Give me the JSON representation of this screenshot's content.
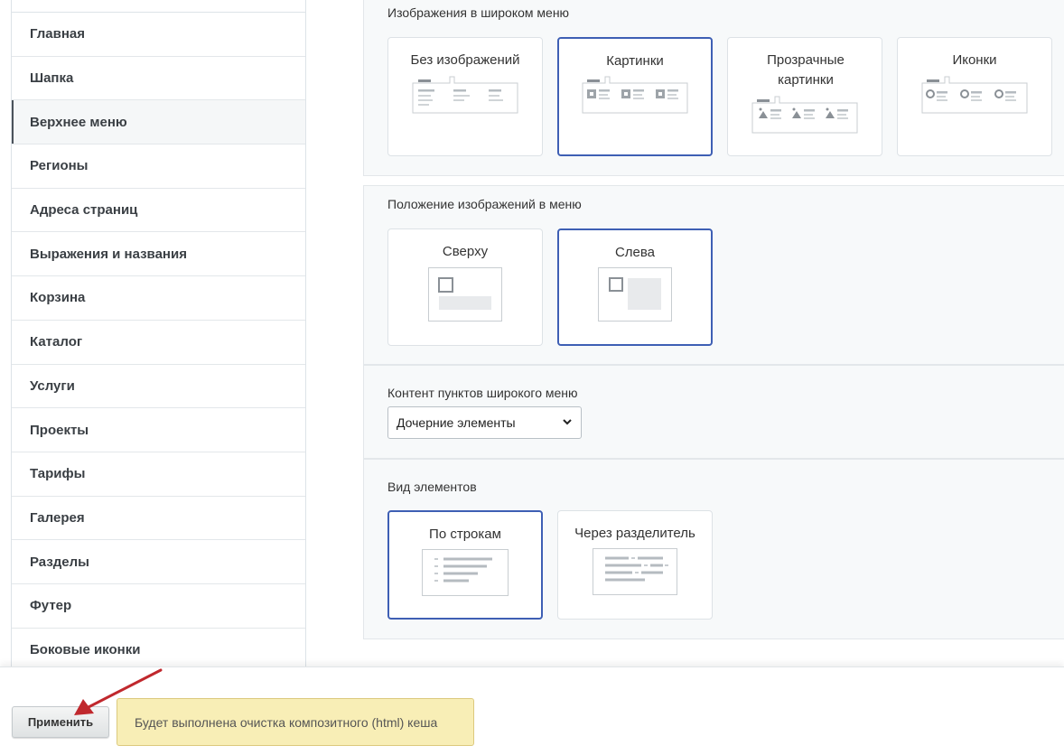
{
  "sidebar": {
    "items": [
      {
        "label": "Главная"
      },
      {
        "label": "Шапка"
      },
      {
        "label": "Верхнее меню"
      },
      {
        "label": "Регионы"
      },
      {
        "label": "Адреса страниц"
      },
      {
        "label": "Выражения и названия"
      },
      {
        "label": "Корзина"
      },
      {
        "label": "Каталог"
      },
      {
        "label": "Услуги"
      },
      {
        "label": "Проекты"
      },
      {
        "label": "Тарифы"
      },
      {
        "label": "Галерея"
      },
      {
        "label": "Разделы"
      },
      {
        "label": "Футер"
      },
      {
        "label": "Боковые иконки"
      }
    ],
    "active_index": 2
  },
  "sections": {
    "images_in_menu": {
      "title": "Изображения в широком меню",
      "options": [
        {
          "label": "Без изображений",
          "selected": false
        },
        {
          "label": "Картинки",
          "selected": true
        },
        {
          "label": "Прозрачные картинки",
          "selected": false
        },
        {
          "label": "Иконки",
          "selected": false
        }
      ]
    },
    "image_position": {
      "title": "Положение изображений в меню",
      "options": [
        {
          "label": "Сверху",
          "selected": false
        },
        {
          "label": "Слева",
          "selected": true
        }
      ]
    },
    "content": {
      "title": "Контент пунктов широкого меню",
      "select_value": "Дочерние элементы"
    },
    "view": {
      "title": "Вид элементов",
      "options": [
        {
          "label": "По строкам",
          "selected": true
        },
        {
          "label": "Через разделитель",
          "selected": false
        }
      ]
    }
  },
  "footer": {
    "apply_label": "Применить",
    "notice": "Будет выполнена очистка композитного (html) кеша"
  },
  "colors": {
    "selected_border": "#3e5fb4",
    "notice_bg": "#f8eeb6",
    "arrow": "#c0282d"
  },
  "icons": [
    "chevron-down-icon",
    "arrow-annotation"
  ]
}
